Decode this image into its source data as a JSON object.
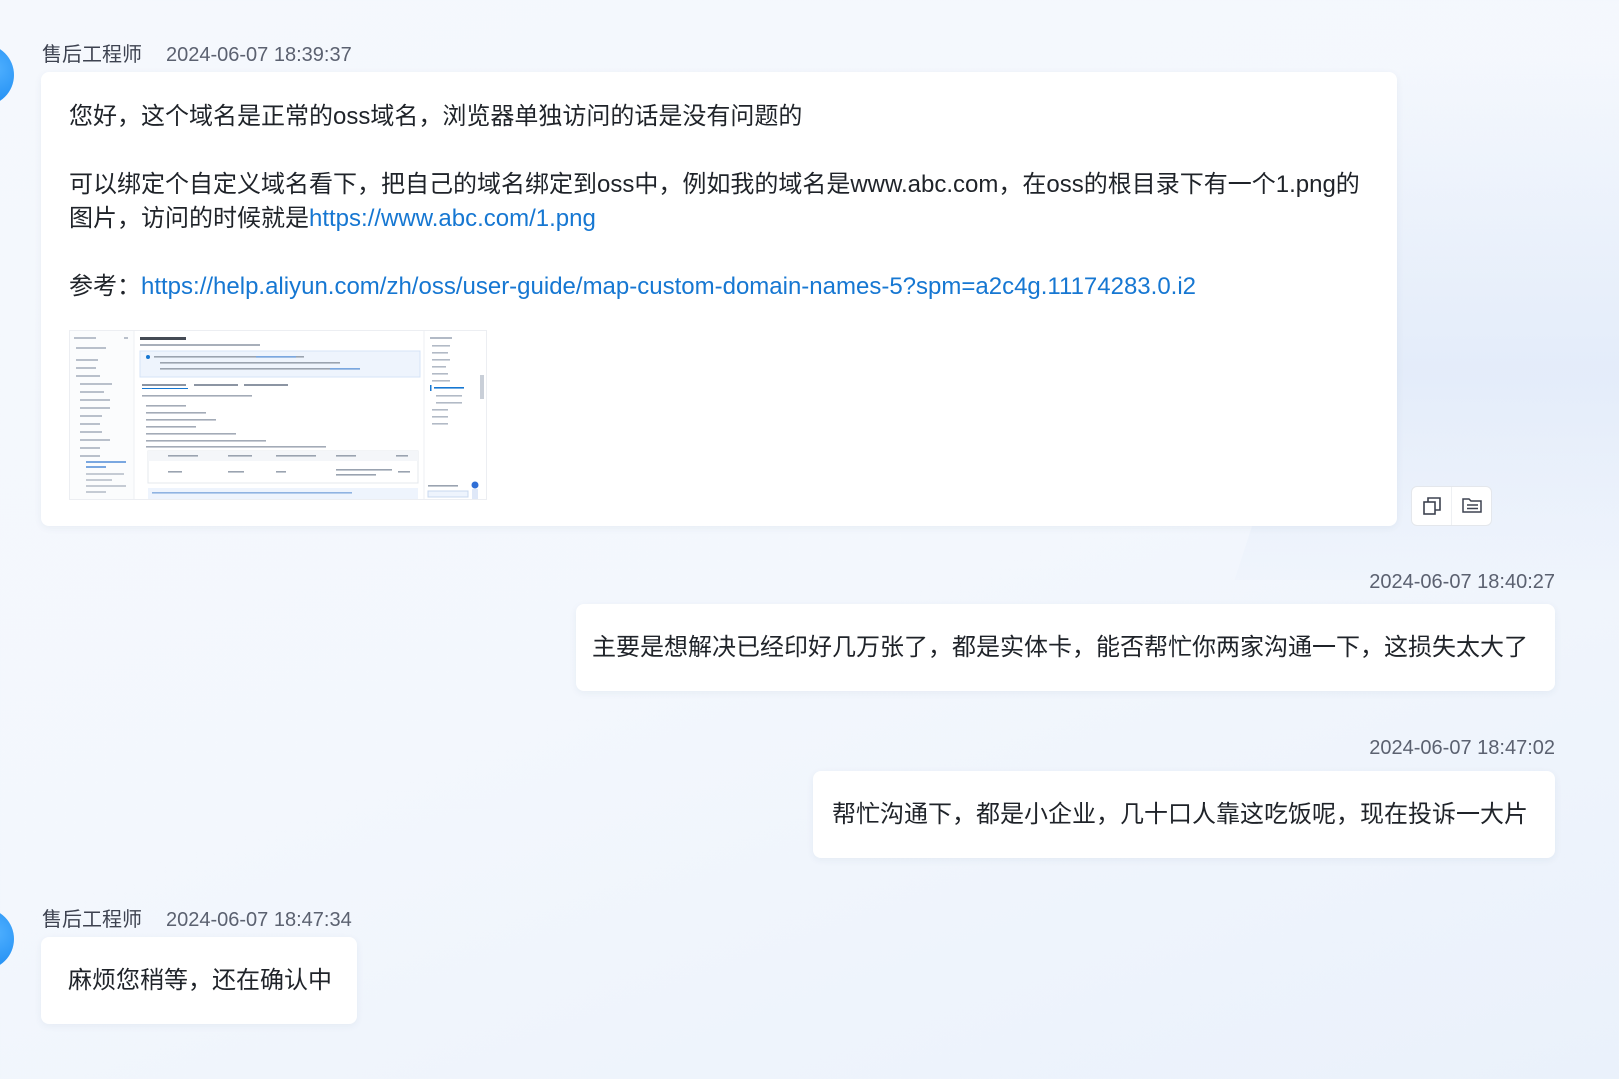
{
  "messages": [
    {
      "sender": "售后工程师",
      "time": "2024-06-07 18:39:37",
      "line1": "您好，这个域名是正常的oss域名，浏览器单独访问的话是没有问题的",
      "line2_text": "可以绑定个自定义域名看下，把自己的域名绑定到oss中，例如我的域名是www.abc.com，在oss的根目录下有一个1.png的图片，访问的时候就是",
      "line2_link": "https://www.abc.com/1.png",
      "ref_label": "参考：",
      "ref_link": "https://help.aliyun.com/zh/oss/user-guide/map-custom-domain-names-5?spm=a2c4g.11174283.0.i2"
    },
    {
      "time": "2024-06-07 18:40:27",
      "text": "主要是想解决已经印好几万张了，都是实体卡，能否帮忙你两家沟通一下，这损失太大了"
    },
    {
      "time": "2024-06-07 18:47:02",
      "text": "帮忙沟通下，都是小企业，几十口人靠这吃饭呢，现在投诉一大片"
    },
    {
      "sender": "售后工程师",
      "time": "2024-06-07 18:47:34",
      "text": "麻烦您稍等，还在确认中"
    }
  ],
  "icons": {
    "copy": "copy-icon",
    "quote": "quote-icon"
  },
  "colors": {
    "link": "#1677d2",
    "avatar": "#1e8cf2"
  }
}
